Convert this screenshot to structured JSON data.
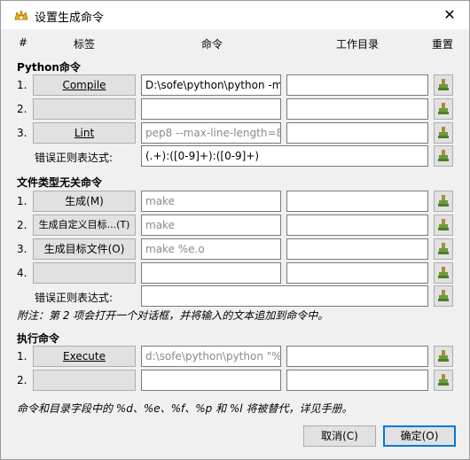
{
  "window": {
    "title": "设置生成命令",
    "close": "✕"
  },
  "headers": {
    "num": "#",
    "label": "标签",
    "command": "命令",
    "workdir": "工作目录",
    "reset": "重置"
  },
  "sections": {
    "python": {
      "title": "Python命令",
      "rows": [
        {
          "num": "1.",
          "label": "Compile",
          "command": "D:\\sofe\\python\\python -m",
          "workdir": ""
        },
        {
          "num": "2.",
          "label": "",
          "command": "",
          "workdir": ""
        },
        {
          "num": "3.",
          "label": "Lint",
          "command": "pep8 --max-line-length=80",
          "workdir": ""
        }
      ],
      "regex_label": "错误正则表达式:",
      "regex_value": "(.+):([0-9]+):([0-9]+)"
    },
    "filetype": {
      "title": "文件类型无关命令",
      "rows": [
        {
          "num": "1.",
          "label": "生成(M)",
          "command": "make",
          "workdir": ""
        },
        {
          "num": "2.",
          "label": "生成自定义目标...(T)",
          "command": "make",
          "workdir": ""
        },
        {
          "num": "3.",
          "label": "生成目标文件(O)",
          "command": "make %e.o",
          "workdir": ""
        },
        {
          "num": "4.",
          "label": "",
          "command": "",
          "workdir": ""
        }
      ],
      "regex_label": "错误正则表达式:",
      "regex_value": ""
    },
    "note": "附注：第 2 项会打开一个对话框，并将输入的文本追加到命令中。",
    "exec": {
      "title": "执行命令",
      "rows": [
        {
          "num": "1.",
          "label": "Execute",
          "command": "d:\\sofe\\python\\python \"%",
          "workdir": ""
        },
        {
          "num": "2.",
          "label": "",
          "command": "",
          "workdir": ""
        }
      ]
    }
  },
  "footer_note": "命令和目录字段中的 %d、%e、%f、%p 和 %l 将被替代，详见手册。",
  "buttons": {
    "cancel": "取消(C)",
    "ok": "确定(O)"
  },
  "colors": {
    "accent": "#0078d7",
    "reset_icon": "#6a9c3a"
  }
}
